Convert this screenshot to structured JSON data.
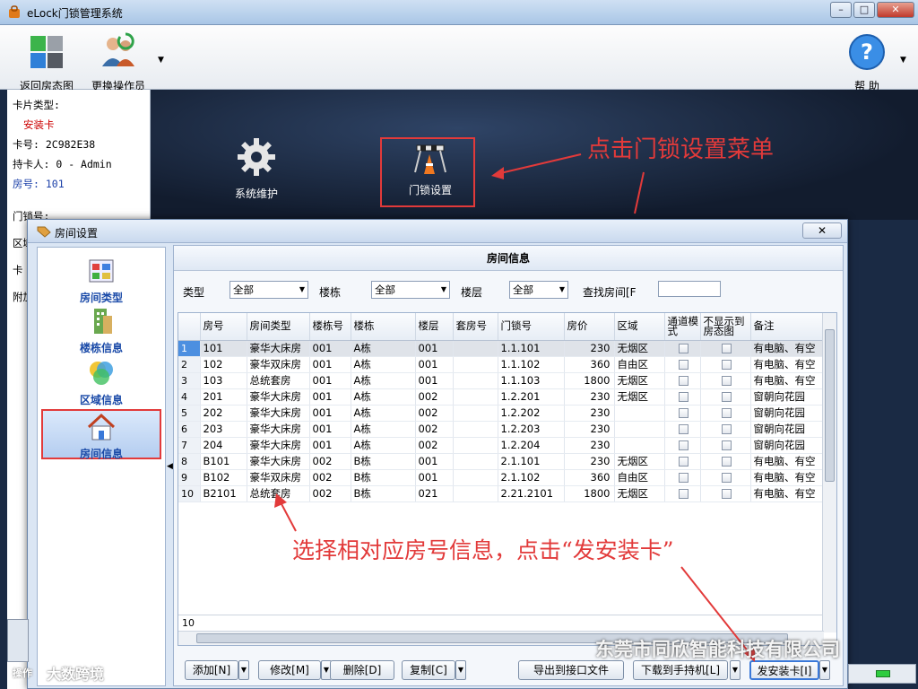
{
  "window": {
    "title": "eLock门锁管理系统"
  },
  "toolbar": {
    "back_label": "返回房态图",
    "switch_label": "更换操作员",
    "help_label": "帮  助"
  },
  "card_info": {
    "type_label": "卡片类型:",
    "type_value": "安装卡",
    "card_no": "卡号: 2C982E38",
    "holder": "持卡人: 0 - Admin",
    "room": "房号: 101",
    "lock_no": "门锁号:",
    "area": "区域",
    "card_short": "卡",
    "attach": "附加"
  },
  "desktop": {
    "sys_maint": "系统维护",
    "lock_setting": "门锁设置",
    "annot_top": "点击门锁设置菜单",
    "annot_bottom": "选择相对应房号信息，点击“发安装卡”"
  },
  "dialog": {
    "title": "房间设置",
    "nav": [
      "房间类型",
      "楼栋信息",
      "区域信息",
      "房间信息"
    ],
    "panel_title": "房间信息",
    "filters": {
      "type_label": "类型",
      "type_value": "全部",
      "bldg_label": "楼栋",
      "bldg_value": "全部",
      "floor_label": "楼层",
      "floor_value": "全部",
      "search_label": "查找房间[F"
    },
    "columns": [
      "房号",
      "房间类型",
      "楼栋号",
      "楼栋",
      "楼层",
      "套房号",
      "门锁号",
      "房价",
      "区域",
      "通道模式",
      "不显示到房态图",
      "备注"
    ],
    "rows": [
      [
        "1",
        "101",
        "豪华大床房",
        "001",
        "A栋",
        "001",
        "",
        "1.1.101",
        "230",
        "无烟区",
        "有电脑、有空"
      ],
      [
        "2",
        "102",
        "豪华双床房",
        "001",
        "A栋",
        "001",
        "",
        "1.1.102",
        "360",
        "自由区",
        "有电脑、有空"
      ],
      [
        "3",
        "103",
        "总统套房",
        "001",
        "A栋",
        "001",
        "",
        "1.1.103",
        "1800",
        "无烟区",
        "有电脑、有空"
      ],
      [
        "4",
        "201",
        "豪华大床房",
        "001",
        "A栋",
        "002",
        "",
        "1.2.201",
        "230",
        "无烟区",
        "窗朝向花园"
      ],
      [
        "5",
        "202",
        "豪华大床房",
        "001",
        "A栋",
        "002",
        "",
        "1.2.202",
        "230",
        "",
        "窗朝向花园"
      ],
      [
        "6",
        "203",
        "豪华大床房",
        "001",
        "A栋",
        "002",
        "",
        "1.2.203",
        "230",
        "",
        "窗朝向花园"
      ],
      [
        "7",
        "204",
        "豪华大床房",
        "001",
        "A栋",
        "002",
        "",
        "1.2.204",
        "230",
        "",
        "窗朝向花园"
      ],
      [
        "8",
        "B101",
        "豪华大床房",
        "002",
        "B栋",
        "001",
        "",
        "2.1.101",
        "230",
        "无烟区",
        "有电脑、有空"
      ],
      [
        "9",
        "B102",
        "豪华双床房",
        "002",
        "B栋",
        "001",
        "",
        "2.1.102",
        "360",
        "自由区",
        "有电脑、有空"
      ],
      [
        "10",
        "B2101",
        "总统套房",
        "002",
        "B栋",
        "021",
        "",
        "2.21.2101",
        "1800",
        "无烟区",
        "有电脑、有空"
      ]
    ],
    "footer_count": "10",
    "buttons": {
      "add": "添加[N]",
      "edit": "修改[M]",
      "delete": "删除[D]",
      "copy": "复制[C]",
      "export": "导出到接口文件",
      "download": "下载到手持机[L]",
      "issue": "发安装卡[I]"
    }
  },
  "watermarks": {
    "left": "大数跨境",
    "right": "东莞市同欣智能科技有限公司",
    "bottom_left": "操作"
  },
  "colors": {
    "annotation": "#e23a3a",
    "selection": "#4c8fe0",
    "nav_text": "#1a4aa8"
  }
}
